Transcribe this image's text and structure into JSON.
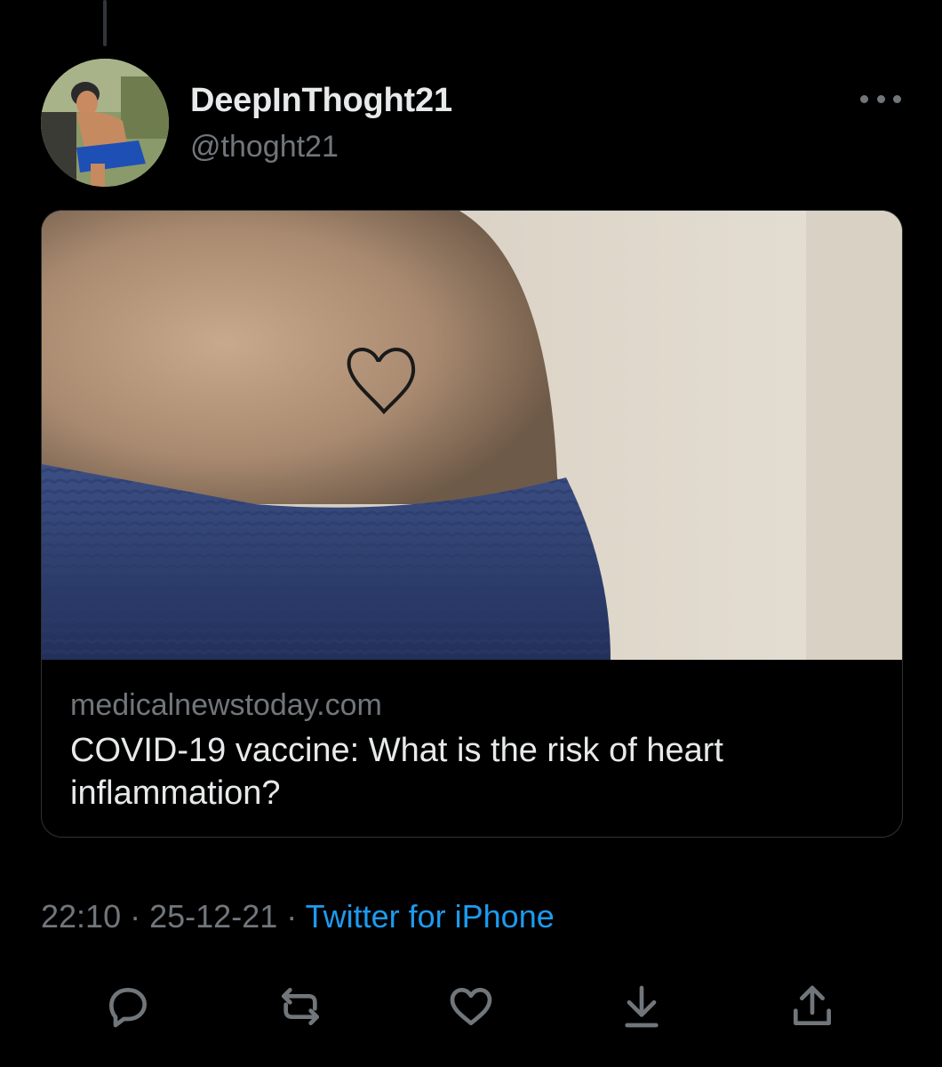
{
  "tweet": {
    "author": {
      "display_name": "DeepInThoght21",
      "handle": "@thoght21"
    },
    "card": {
      "domain": "medicalnewstoday.com",
      "headline": "COVID-19 vaccine: What is the risk of heart inflammation?"
    },
    "meta": {
      "time": "22:10",
      "separator": "·",
      "date": "25-12-21",
      "source": "Twitter for iPhone"
    },
    "actions": [
      "reply-icon",
      "retweet-icon",
      "like-icon",
      "download-icon",
      "share-icon"
    ]
  },
  "colors": {
    "background": "#000000",
    "primary_text": "#e7e9ea",
    "secondary_text": "#71767b",
    "link": "#1d9bf0",
    "border": "#2f3336"
  }
}
